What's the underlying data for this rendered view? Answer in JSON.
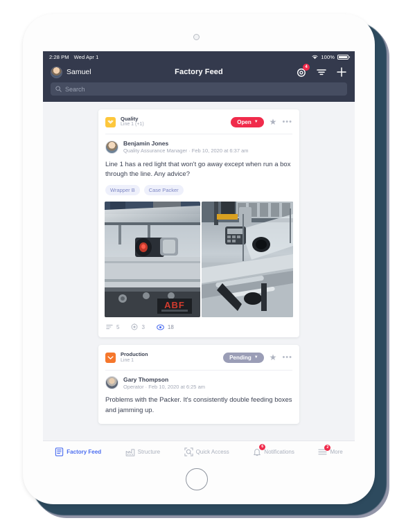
{
  "device": {
    "frame": "tablet-white",
    "shadow_color": "#2d4a5e"
  },
  "status_bar": {
    "time": "2:28 PM",
    "date": "Wed Apr 1",
    "battery_percent": "100%",
    "wifi_icon": "wifi-icon",
    "battery_icon": "battery-icon"
  },
  "nav": {
    "user_name": "Samuel",
    "title": "Factory Feed",
    "avatar_icon": "user-avatar",
    "notifications_icon": "activity-ring-icon",
    "notifications_badge": "4",
    "filter_icon": "filter-icon",
    "add_icon": "plus-icon"
  },
  "search": {
    "placeholder": "Search",
    "value": "",
    "icon": "search-icon"
  },
  "colors": {
    "nav_bg": "#343a4d",
    "feed_bg": "#f2f3f6",
    "accent_blue": "#4a6cf0",
    "status_open": "#f02b4b",
    "status_pending": "#9a9db6",
    "quality_yellow": "#fdc73c",
    "production_orange": "#f5772c",
    "tag_text": "#7e87c4"
  },
  "posts": [
    {
      "category": "Quality",
      "category_icon": "quality-icon",
      "line": "Line 1 (+1)",
      "status": "Open",
      "status_chevron": "chevron-down-icon",
      "star_icon": "star-icon",
      "more_icon": "more-options-icon",
      "author": "Benjamin Jones",
      "author_meta": "Quality Assurance Manager · Feb 10, 2020 at 6:37 am",
      "text": "Line 1 has a red light that won't go away except when run a box through the line. Any advice?",
      "tags": [
        "Wrapper B",
        "Case Packer"
      ],
      "images": [
        {
          "alt": "Conveyor machine with red indicator light and ABF label"
        },
        {
          "alt": "Packaging line with control panel and clear guard"
        }
      ],
      "stats": {
        "comments_icon": "comments-icon",
        "comments": "5",
        "actions_icon": "target-icon",
        "actions": "3",
        "views_icon": "eye-icon",
        "views": "18"
      }
    },
    {
      "category": "Production",
      "category_icon": "production-icon",
      "line": "Line 1",
      "status": "Pending",
      "status_chevron": "chevron-down-icon",
      "star_icon": "star-icon",
      "more_icon": "more-options-icon",
      "author": "Gary Thompson",
      "author_meta": "Operator · Feb 10, 2020 at 6:25 am",
      "text": "Problems with the Packer. It's consistently double feeding boxes and jamming up.",
      "tags": [],
      "images": [],
      "stats": {}
    }
  ],
  "tabs": [
    {
      "label": "Factory Feed",
      "icon": "feed-icon",
      "active": true,
      "badge": ""
    },
    {
      "label": "Structure",
      "icon": "factory-icon",
      "active": false,
      "badge": ""
    },
    {
      "label": "Quick Access",
      "icon": "scan-icon",
      "active": false,
      "badge": ""
    },
    {
      "label": "Notifications",
      "icon": "bell-icon",
      "active": false,
      "badge": "6"
    },
    {
      "label": "More",
      "icon": "menu-icon",
      "active": false,
      "badge": "2"
    }
  ]
}
